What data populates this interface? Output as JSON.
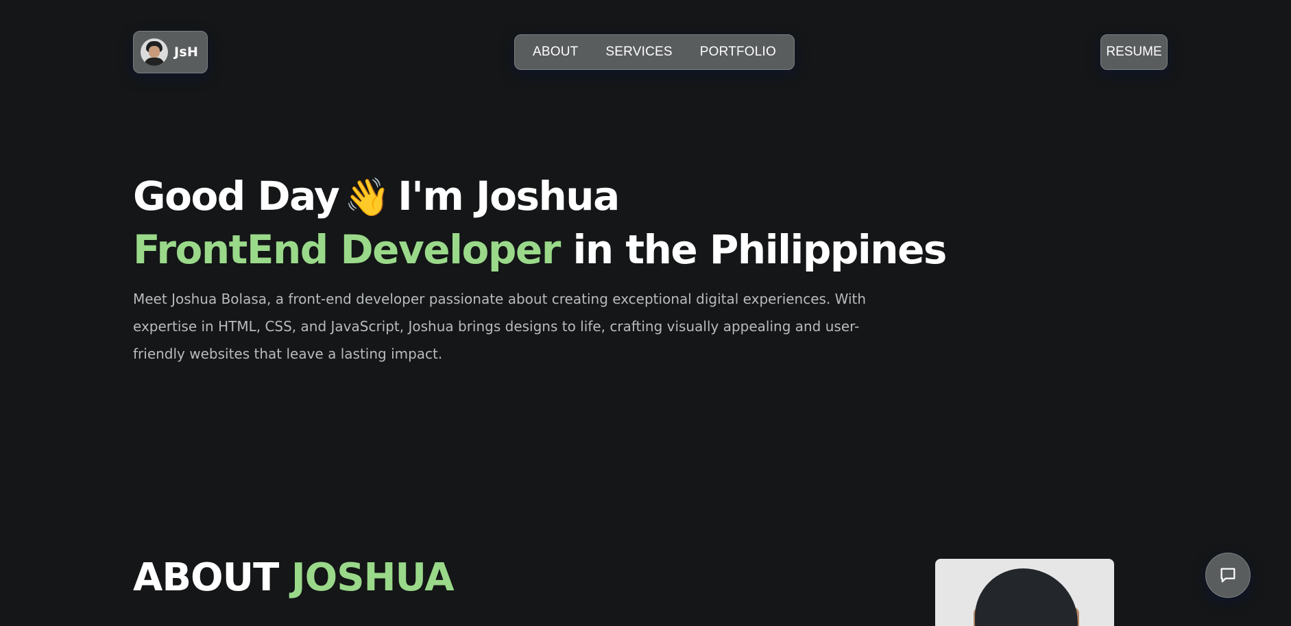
{
  "header": {
    "logo_text": "JsH",
    "nav": [
      {
        "label": "ABOUT"
      },
      {
        "label": "SERVICES"
      },
      {
        "label": "PORTFOLIO"
      }
    ],
    "resume_label": "RESUME"
  },
  "hero": {
    "greeting": "Good Day",
    "wave": "👋",
    "name_line": "I'm Joshua",
    "role": "FrontEnd Developer",
    "location": "in the Philippines",
    "description": "Meet Joshua Bolasa, a front-end developer passionate about creating exceptional digital experiences. With expertise in HTML, CSS, and JavaScript, Joshua brings designs to life, crafting visually appealing and user-friendly websites that leave a lasting impact."
  },
  "about": {
    "title_white": "ABOUT",
    "title_green": "JOSHUA"
  },
  "colors": {
    "background": "#141617",
    "accent": "#9ad98a",
    "button": "#5a5d5e",
    "body_text": "#b9bcbd"
  },
  "icons": {
    "chat": "chat-bubble-icon",
    "avatar": "avatar"
  }
}
